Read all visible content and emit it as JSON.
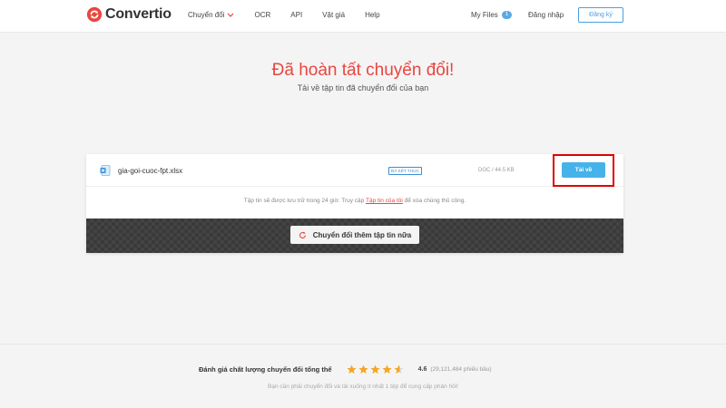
{
  "brand": {
    "name": "Convertio",
    "color": "#e9463f"
  },
  "nav": {
    "items": [
      {
        "label": "Chuyển đổi"
      },
      {
        "label": "OCR"
      },
      {
        "label": "API"
      },
      {
        "label": "Vật giá"
      },
      {
        "label": "Help"
      }
    ],
    "my_files": "My Files",
    "my_files_count": "1",
    "login": "Đăng nhập",
    "signup": "Đăng ký"
  },
  "hero": {
    "title": "Đã hoàn tất chuyển đổi!",
    "subtitle": "Tải về tập tin đã chuyển đổi của bạn"
  },
  "file": {
    "name": "gia-goi-cuoc-fpt.xlsx",
    "status": "ĐÃ KẾT THÚC",
    "size": "DOC / 44.5 KB",
    "download_label": "Tải về",
    "icon": "excel-file-icon"
  },
  "note": {
    "before": "Tập tin sẽ được lưu trữ trong 24 giờ. Truy cập ",
    "link": "Tập tin của tôi",
    "after": " để xóa chúng thủ công."
  },
  "convert_more": "Chuyển đổi thêm tập tin nữa",
  "footer": {
    "rating_label": "Đánh giá chất lượng chuyển đổi tổng thể",
    "rating_value": "4.6",
    "rating_count": "(29,121,484 phiếu bầu)",
    "stars": 4.6,
    "note": "Bạn cần phải chuyển đổi và tải xuống ít nhất 1 tệp để cung cấp phản hồi!"
  },
  "colors": {
    "accent": "#45b3ea",
    "highlight": "#e00000",
    "star": "#f5a623"
  }
}
